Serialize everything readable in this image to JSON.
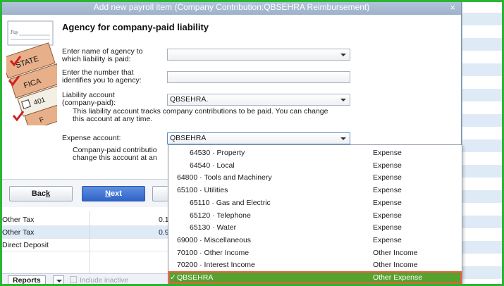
{
  "dialog": {
    "title": "Add new payroll item (Company Contribution:QBSEHRA Reimbursement)",
    "close": "×",
    "heading": "Agency for company-paid liability",
    "art_labels": [
      "Pay",
      "STATE",
      "FICA",
      "401",
      "F"
    ],
    "agency_name_label": "Enter name of agency to which liability is paid:",
    "agency_name_value": "",
    "agency_number_label": "Enter the number that identifies you to agency:",
    "agency_number_value": "",
    "liability_label": "Liability account (company-paid):",
    "liability_value": "QBSEHRA.",
    "liability_note": "This liability account tracks company contributions to be paid. You can change this account at any time.",
    "expense_label": "Expense account:",
    "expense_value": "QBSEHRA",
    "expense_note_line1": "Company-paid contributio",
    "expense_note_line2": "change this account at an",
    "buttons": {
      "back_prefix": "Bac",
      "back_underline": "k",
      "next_underline": "N",
      "next_suffix": "ext"
    }
  },
  "dropdown_items": [
    {
      "name": "64530 · Property",
      "type": "Expense",
      "indent": 2
    },
    {
      "name": "64540 · Local",
      "type": "Expense",
      "indent": 2
    },
    {
      "name": "64800 · Tools and Machinery",
      "type": "Expense",
      "indent": 1
    },
    {
      "name": "65100 · Utilities",
      "type": "Expense",
      "indent": 1
    },
    {
      "name": "65110 · Gas and Electric",
      "type": "Expense",
      "indent": 2
    },
    {
      "name": "65120 · Telephone",
      "type": "Expense",
      "indent": 2
    },
    {
      "name": "65130 · Water",
      "type": "Expense",
      "indent": 2
    },
    {
      "name": "69000 · Miscellaneous",
      "type": "Expense",
      "indent": 1
    },
    {
      "name": "70100 · Other Income",
      "type": "Other Income",
      "indent": 1
    },
    {
      "name": "70200 · Interest Income",
      "type": "Other Income",
      "indent": 1
    },
    {
      "name": "QBSEHRA",
      "type": "Other Expense",
      "indent": 1,
      "selected": true,
      "check": "✓"
    }
  ],
  "background_table": {
    "rows": [
      {
        "type": "Other Tax",
        "value": "0.1"
      },
      {
        "type": "Other Tax",
        "value": "0.9"
      },
      {
        "type": "Direct Deposit",
        "value": ""
      }
    ]
  },
  "bottom_bar": {
    "reports_label": "Reports",
    "include_inactive_label": "Include inactive"
  },
  "colors": {
    "frame": "#2bb534",
    "selected_row": "#57a12e",
    "highlight_outline": "#e3623a",
    "next_button": "#2f63c8"
  }
}
